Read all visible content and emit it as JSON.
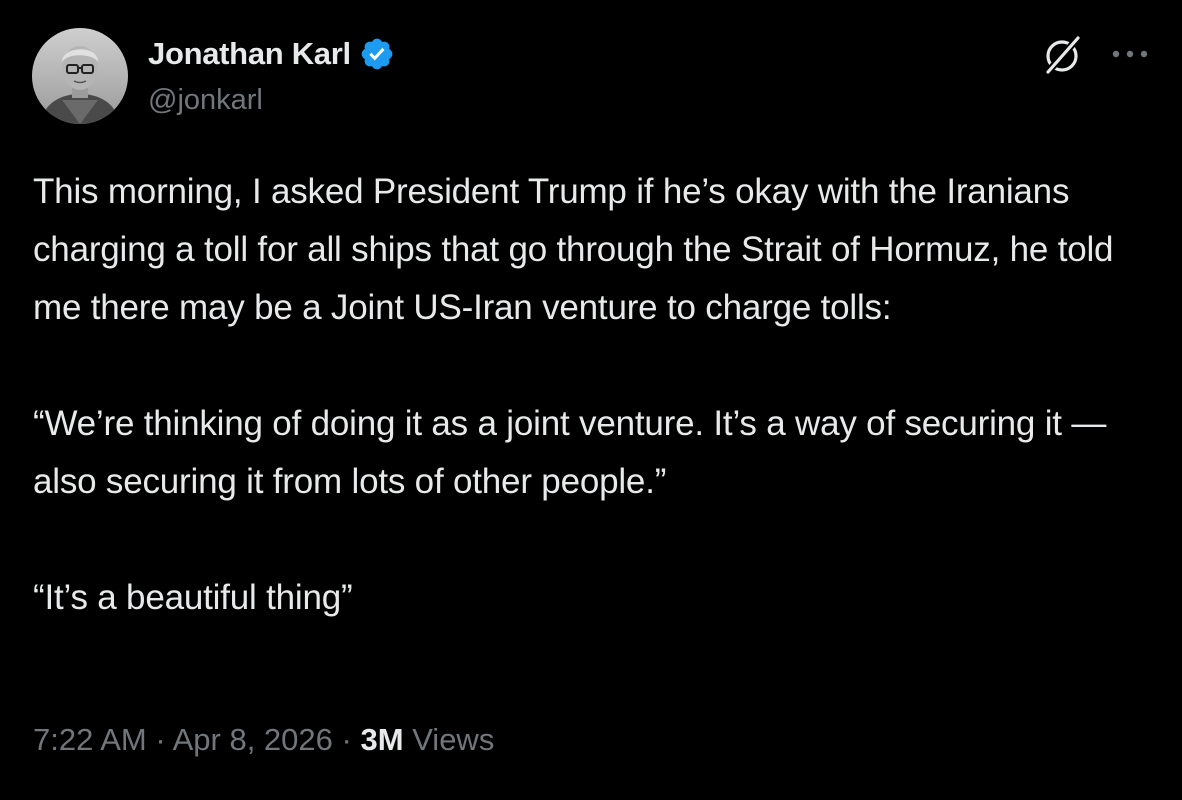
{
  "author": {
    "display_name": "Jonathan Karl",
    "handle": "@jonkarl",
    "verified_icon": "verified-badge-icon",
    "avatar_icon": "profile-photo"
  },
  "header_actions": {
    "grok_icon": "grok-icon",
    "more_icon": "more-options-icon"
  },
  "tweet": {
    "paragraphs": [
      "This morning, I asked President Trump if he’s okay with the Iranians charging a toll for all ships that go through the Strait of Hormuz, he told me there may be a Joint US-Iran venture to charge tolls:",
      "“We’re thinking of doing it as a joint venture. It’s a way of securing it — also securing it from lots of other people.”",
      "“It’s a beautiful thing”"
    ],
    "time": "7:22 AM",
    "separator": "·",
    "date": "Apr 8, 2026",
    "views_count": "3M",
    "views_label": "Views"
  },
  "colors": {
    "background": "#000000",
    "text_primary": "#e7e9ea",
    "text_secondary": "#71767b",
    "verified_blue": "#1d9bf0"
  }
}
